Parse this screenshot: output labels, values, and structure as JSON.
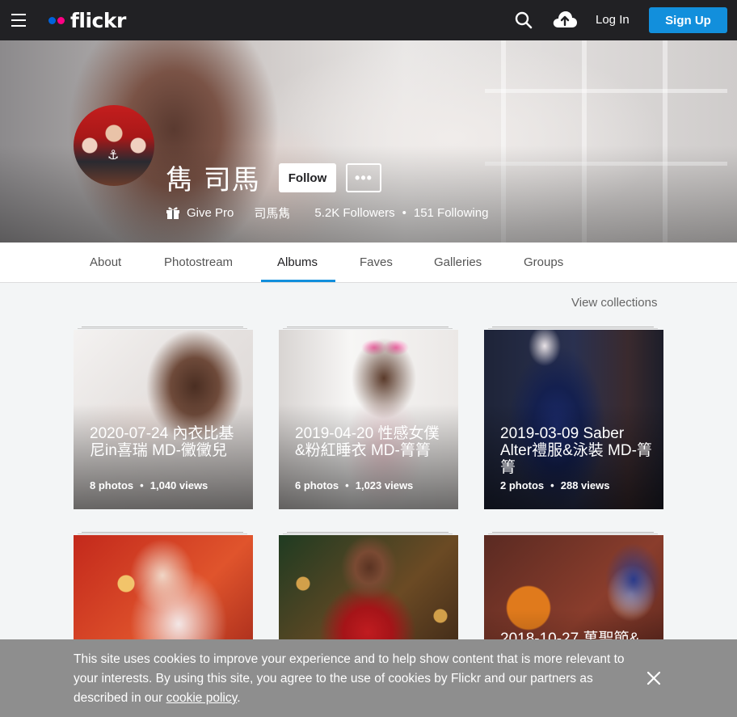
{
  "nav": {
    "brand": "flickr",
    "login_label": "Log In",
    "signup_label": "Sign Up",
    "brand_colors": {
      "blue": "#0063dc",
      "pink": "#ff0084",
      "accent": "#128fdc"
    }
  },
  "profile": {
    "display_name": "雋 司馬",
    "follow_label": "Follow",
    "more_label": "•••",
    "give_pro_label": "Give Pro",
    "real_name": "司馬雋",
    "followers": "5.2K Followers",
    "separator": "•",
    "following": "151 Following"
  },
  "tabs": [
    {
      "label": "About"
    },
    {
      "label": "Photostream"
    },
    {
      "label": "Albums"
    },
    {
      "label": "Faves"
    },
    {
      "label": "Galleries"
    },
    {
      "label": "Groups"
    }
  ],
  "active_tab": "Albums",
  "view_collections_label": "View collections",
  "albums": [
    {
      "title": "2020-07-24 內衣比基尼in喜瑞 MD-黴黴兒",
      "photos": "8 photos",
      "views": "1,040 views"
    },
    {
      "title": "2019-04-20 性感女僕&粉紅睡衣 MD-箐箐",
      "photos": "6 photos",
      "views": "1,023 views"
    },
    {
      "title": "2019-03-09 Saber Alter禮服&泳裝 MD-箐箐",
      "photos": "2 photos",
      "views": "288 views"
    },
    {
      "title": "",
      "photos": "",
      "views": ""
    },
    {
      "title": "",
      "photos": "",
      "views": ""
    },
    {
      "title": "2018-10-27 萬聖節&",
      "photos": "",
      "views": ""
    }
  ],
  "stat_separator": "•",
  "cookie": {
    "text": "This site uses cookies to improve your experience and to help show content that is more relevant to your interests. By using this site, you agree to the use of cookies by Flickr and our partners as described in our ",
    "link_label": "cookie policy",
    "trailing": "."
  }
}
